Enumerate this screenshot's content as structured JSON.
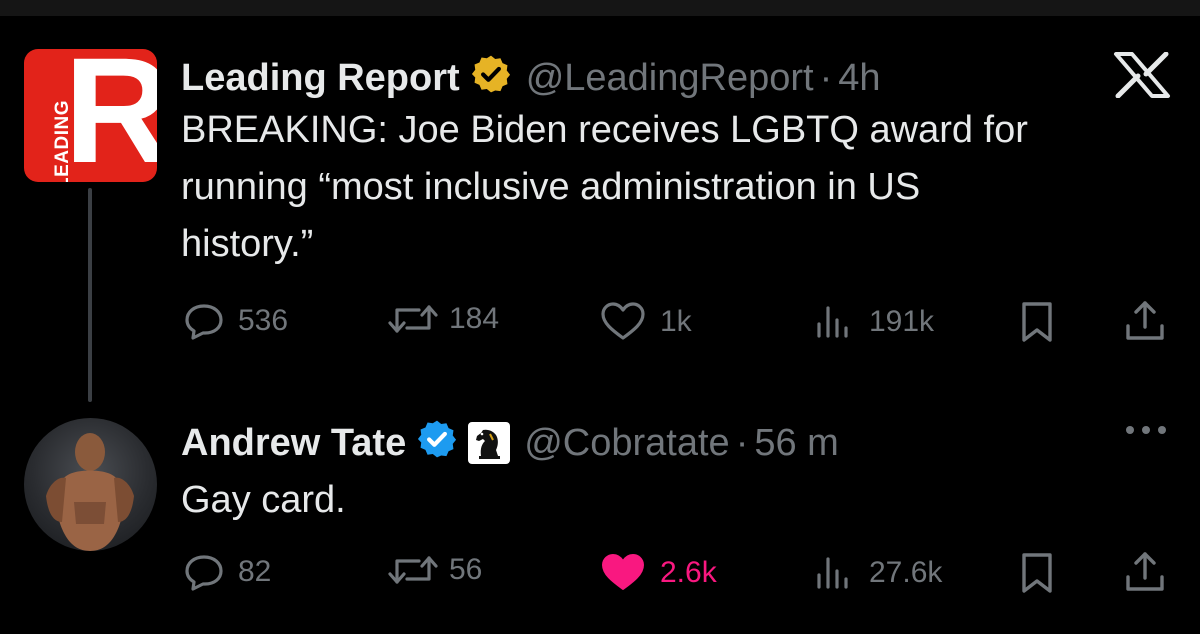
{
  "colors": {
    "background": "#000000",
    "text_primary": "#e7e9ea",
    "text_secondary": "#71767b",
    "verified_gold": "#e6b325",
    "verified_blue": "#1d9bf0",
    "like_active": "#f91880",
    "brand_red": "#e2231a"
  },
  "tweet1": {
    "author_name": "Leading Report",
    "handle": "@LeadingReport",
    "separator": "·",
    "time": "4h",
    "avatar_letter": "R",
    "avatar_word": "LEADING",
    "verified_badge": "gold-check-icon",
    "text_line1": "BREAKING: Joe Biden receives LGBTQ award for",
    "text_line2": "running “most inclusive administration in US",
    "text_line3": "history.”",
    "actions": {
      "replies": "536",
      "reposts": "184",
      "likes": "1k",
      "views": "191k"
    }
  },
  "tweet2": {
    "author_name": "Andrew Tate",
    "handle": "@Cobratate",
    "separator": "·",
    "time": "56 m",
    "verified_badge": "blue-check-icon",
    "affiliation_icon": "chess-knight-icon",
    "text": "Gay card.",
    "actions": {
      "replies": "82",
      "reposts": "56",
      "likes": "2.6k",
      "likes_active": true,
      "views": "27.6k"
    }
  },
  "icons": {
    "brand": "x-logo-icon",
    "more": "more-options-icon",
    "reply": "reply-icon",
    "repost": "repost-icon",
    "like": "heart-icon",
    "views": "views-icon",
    "bookmark": "bookmark-icon",
    "share": "share-icon"
  }
}
